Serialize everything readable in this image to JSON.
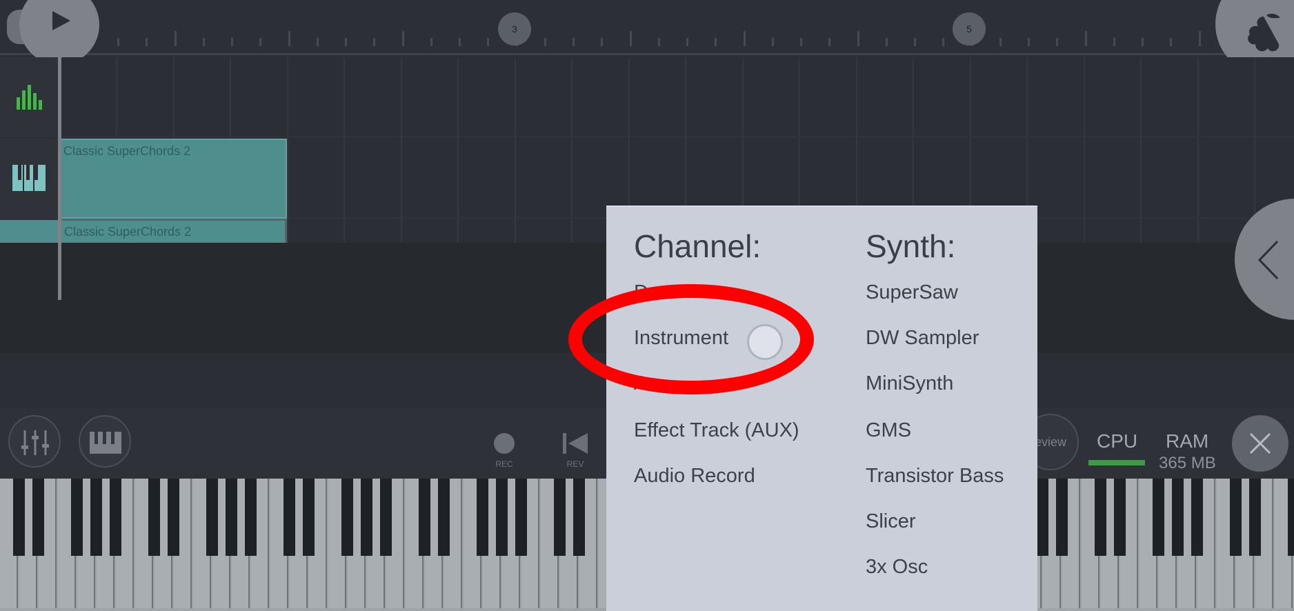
{
  "timeline": {
    "bar_markers": [
      "3",
      "5"
    ]
  },
  "tracks": [
    {
      "icon": "mixer-bars-icon",
      "clip": ""
    },
    {
      "icon": "piano-keys-icon",
      "clip": "Classic SuperChords 2"
    },
    {
      "icon": "piano-keys-icon",
      "clip": "Classic SuperChords 2"
    }
  ],
  "toolbar": {
    "rec_label": "REC",
    "rev_label": "REV",
    "preview_label": "eview",
    "cpu_label": "CPU",
    "ram_label": "RAM",
    "ram_value": "365 MB"
  },
  "popup": {
    "channel_title": "Channel:",
    "synth_title": "Synth:",
    "channel_items": [
      "D",
      "Instrument",
      "A",
      "Effect Track (AUX)",
      "Audio Record"
    ],
    "synth_items": [
      "SuperSaw",
      "DW Sampler",
      "MiniSynth",
      "GMS",
      "Transistor Bass",
      "Slicer",
      "3x Osc"
    ]
  },
  "colors": {
    "background": "#2b2f35",
    "clip": "#4e8f8e",
    "popup": "#cbcfda",
    "highlight": "#ff0000",
    "cpu_meter": "#3f9a44",
    "mixer_icon": "#4caf50"
  },
  "icons": {
    "play": "play-icon",
    "fruit": "fl-fruit-logo-icon",
    "back": "chevron-left-icon",
    "close": "close-icon",
    "mixer": "mixer-sliders-icon",
    "piano": "piano-keys-icon",
    "rewind": "skip-back-icon"
  }
}
